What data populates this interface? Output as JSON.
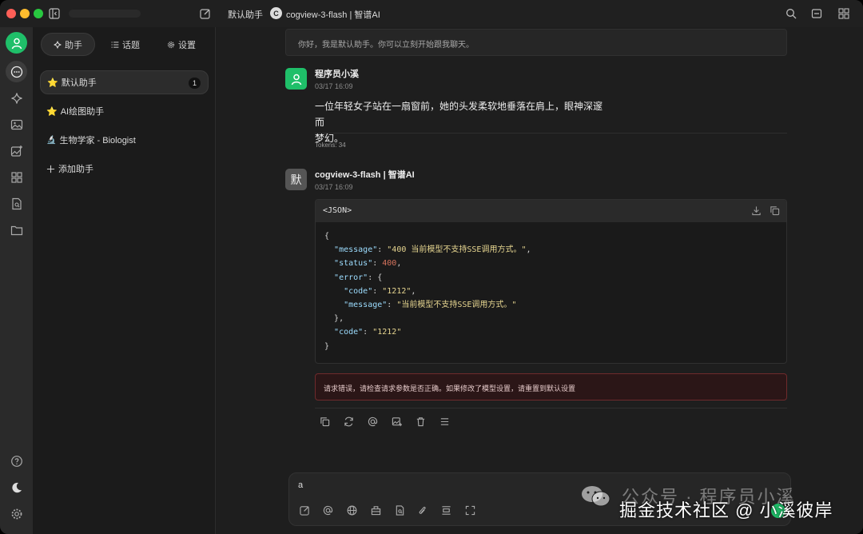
{
  "titlebar": {
    "assistant_title": "默认助手",
    "model_badge": "C",
    "model_title": "cogview-3-flash | 智谱AI"
  },
  "sidebar": {
    "tabs": [
      {
        "label": "助手",
        "icon": "sparkle-icon"
      },
      {
        "label": "话题",
        "icon": "list-icon"
      },
      {
        "label": "设置",
        "icon": "gear-icon"
      }
    ],
    "assistants": [
      {
        "label": "默认助手",
        "prefix": "⭐",
        "count": "1"
      },
      {
        "label": "AI绘图助手",
        "prefix": "⭐"
      },
      {
        "label": "生物学家 - Biologist",
        "prefix": "🔬"
      }
    ],
    "add_label": "添加助手"
  },
  "chat": {
    "greeting": "你好，我是默认助手。你可以立刻开始跟我聊天。",
    "user_message": {
      "name": "程序员小溪",
      "time": "03/17 16:09",
      "text_line1": "一位年轻女子站在一扇窗前，她的头发柔软地垂落在肩上，眼神深邃而",
      "text_line2": "梦幻。",
      "tokens": "Tokens: 34"
    },
    "bot_message": {
      "avatar_char": "默",
      "name": "cogview-3-flash | 智谱AI",
      "time": "03/17 16:09",
      "code_lang": "<JSON>",
      "error": "请求错误，请检查请求参数是否正确。如果修改了模型设置，请重置到默认设置"
    }
  },
  "code": {
    "brace_open": "{",
    "k_message": "\"message\"",
    "v_message": "\"400 当前模型不支持SSE调用方式。\"",
    "k_status": "\"status\"",
    "v_status": "400",
    "k_error": "\"error\"",
    "k_code_inner": "\"code\"",
    "v_code_inner": "\"1212\"",
    "k_message_inner": "\"message\"",
    "v_message_inner": "\"当前模型不支持SSE调用方式。\"",
    "k_code": "\"code\"",
    "v_code": "\"1212\"",
    "brace_close": "}"
  },
  "input": {
    "value": "a"
  },
  "watermark": {
    "line1": "公众号 · 程序员小溪",
    "line2": "掘金技术社区 @ 小溪彼岸"
  },
  "colors": {
    "accent_green": "#1fbf69",
    "error_border": "#6e2a2c",
    "error_bg": "#2b1617"
  }
}
